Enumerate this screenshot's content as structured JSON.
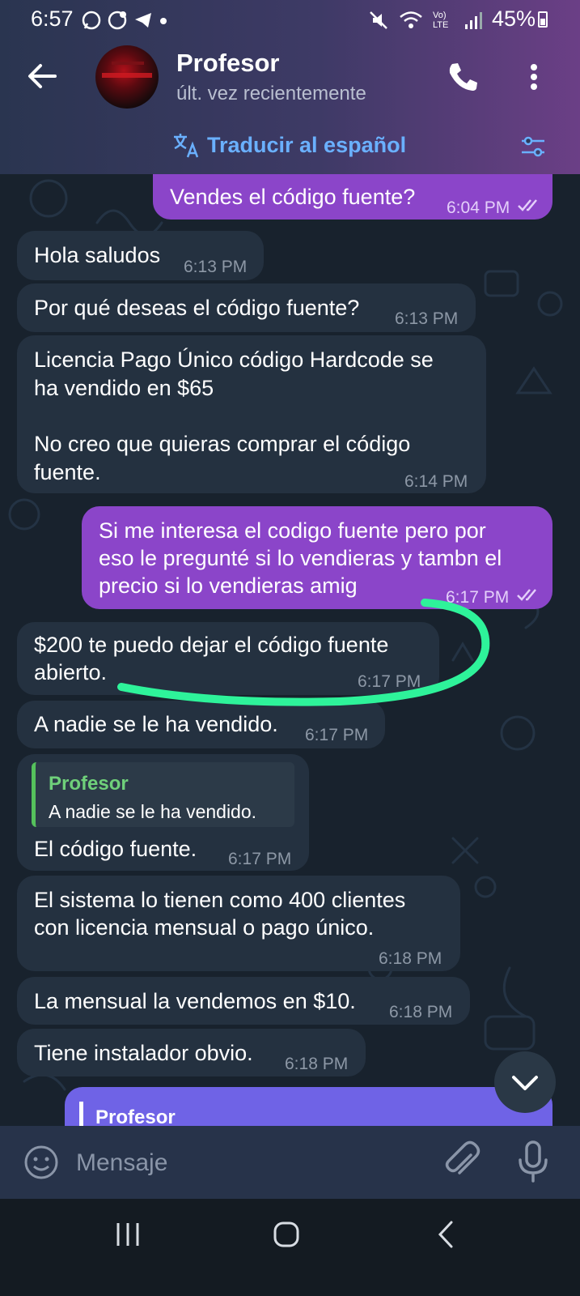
{
  "status_bar": {
    "time": "6:57",
    "battery": "45%",
    "network": "Vo) LTE"
  },
  "header": {
    "contact_name": "Profesor",
    "contact_status": "últ. vez recientemente",
    "translate_label": "Traducir al español"
  },
  "messages": [
    {
      "direction": "out",
      "text": "Vendes el código fuente?",
      "time": "6:04 PM",
      "read": true
    },
    {
      "direction": "in",
      "text": "Hola saludos",
      "time": "6:13 PM"
    },
    {
      "direction": "in",
      "text": "Por qué deseas el código fuente?",
      "time": "6:13 PM"
    },
    {
      "direction": "in",
      "lines": [
        "Licencia Pago Único código Hardcode se",
        "ha vendido en $65",
        "",
        "No creo que quieras comprar el código",
        "fuente."
      ],
      "time": "6:14 PM"
    },
    {
      "direction": "out",
      "lines": [
        "Si me interesa el codigo fuente pero por",
        "eso le pregunté si lo vendieras y tambn el",
        "precio si lo vendieras amig"
      ],
      "time": "6:17 PM",
      "read": true
    },
    {
      "direction": "in",
      "lines": [
        "$200 te puedo dejar el código fuente",
        "abierto."
      ],
      "time": "6:17 PM"
    },
    {
      "direction": "in",
      "text": "A nadie se le ha vendido.",
      "time": "6:17 PM"
    },
    {
      "direction": "in",
      "reply_to": {
        "name": "Profesor",
        "text": "A nadie se le ha vendido."
      },
      "text": "El código fuente.",
      "time": "6:17 PM"
    },
    {
      "direction": "in",
      "lines": [
        "El sistema lo tienen como 400 clientes",
        "con licencia mensual o pago único."
      ],
      "time": "6:18 PM"
    },
    {
      "direction": "in",
      "text": "La mensual la vendemos en $10.",
      "time": "6:18 PM"
    },
    {
      "direction": "in",
      "text": "Tiene instalador obvio.",
      "time": "6:18 PM"
    }
  ],
  "partial_message": {
    "reply_name": "Profesor"
  },
  "input": {
    "placeholder": "Mensaje"
  },
  "colors": {
    "incoming_bubble": "#243140",
    "outgoing_bubble": "#8b45c9",
    "accent_blue": "#6ab0ff",
    "highlight_green": "#2ef39a"
  }
}
